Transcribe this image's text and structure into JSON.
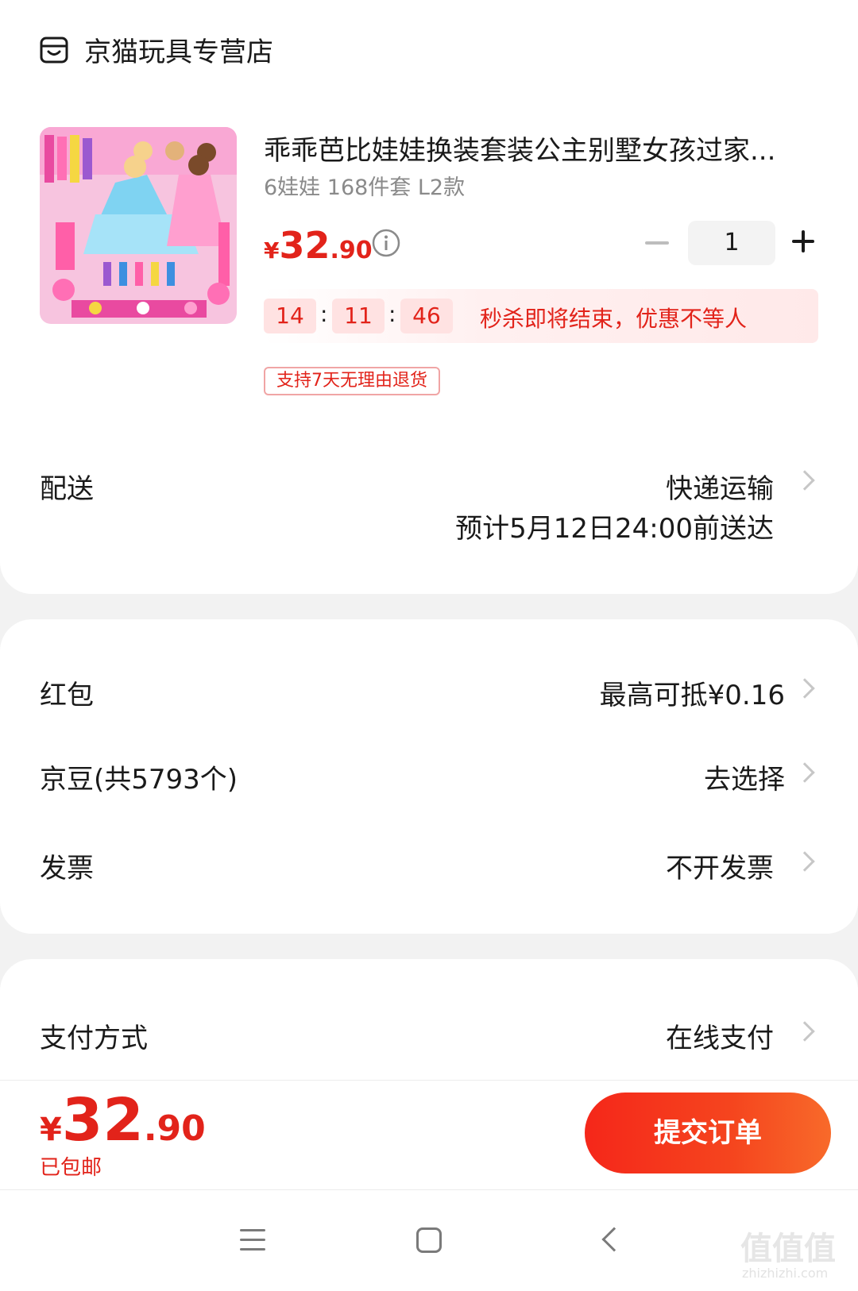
{
  "store": {
    "name": "京猫玩具专营店",
    "icon": "store-icon"
  },
  "product": {
    "title": "乖乖芭比娃娃换装套装公主别墅女孩过家...",
    "spec": "6娃娃 168件套 L2款",
    "price": {
      "currency": "¥",
      "integer": "32",
      "decimal": ".90"
    },
    "quantity": "1",
    "countdown": {
      "hours": "14",
      "minutes": "11",
      "seconds": "46",
      "sep": ":"
    },
    "flash_text": "秒杀即将结束，优惠不等人",
    "return_badge": "支持7天无理由退货"
  },
  "delivery": {
    "label": "配送",
    "method": "快递运输",
    "eta": "预计5月12日24:00前送达"
  },
  "red_packet": {
    "label": "红包",
    "value": "最高可抵¥0.16"
  },
  "jd_beans": {
    "label": "京豆(共5793个)",
    "value": "去选择"
  },
  "invoice": {
    "label": "发票",
    "value": "不开发票"
  },
  "payment": {
    "label": "支付方式",
    "value": "在线支付"
  },
  "footer": {
    "total": {
      "currency": "¥",
      "integer": "32",
      "decimal": ".90"
    },
    "shipping": "已包邮",
    "submit_label": "提交订单"
  },
  "watermark": {
    "text": "值值值",
    "sub": "zhizhizhi.com"
  },
  "colors": {
    "accent": "#e2231a",
    "button_start": "#f5271a",
    "button_end": "#f86a2a"
  }
}
